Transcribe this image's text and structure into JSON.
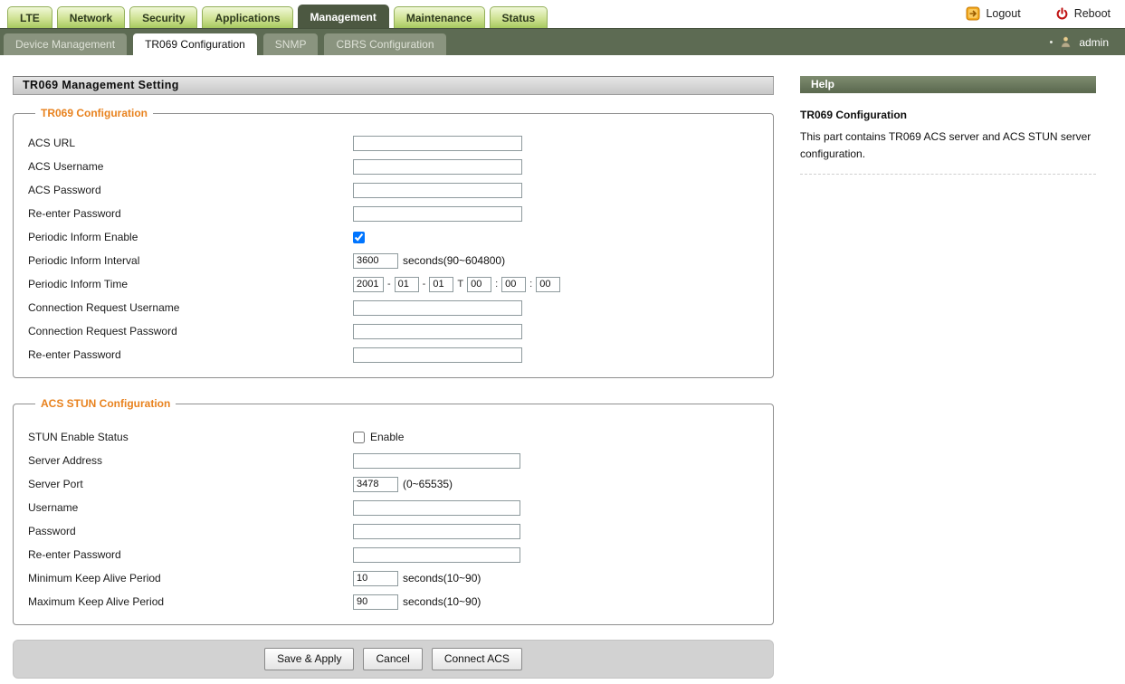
{
  "header": {
    "tabs": [
      {
        "label": "LTE"
      },
      {
        "label": "Network"
      },
      {
        "label": "Security"
      },
      {
        "label": "Applications"
      },
      {
        "label": "Management"
      },
      {
        "label": "Maintenance"
      },
      {
        "label": "Status"
      }
    ],
    "logout_label": "Logout",
    "reboot_label": "Reboot"
  },
  "subnav": {
    "tabs": [
      {
        "label": "Device Management"
      },
      {
        "label": "TR069 Configuration"
      },
      {
        "label": "SNMP"
      },
      {
        "label": "CBRS Configuration"
      }
    ],
    "bullet": "•",
    "user": "admin"
  },
  "main": {
    "title": "TR069 Management Setting",
    "tr069": {
      "legend": "TR069 Configuration",
      "acs_url_label": "ACS URL",
      "acs_username_label": "ACS Username",
      "acs_password_label": "ACS Password",
      "reenter_password_label": "Re-enter Password",
      "periodic_inform_enable_label": "Periodic Inform Enable",
      "periodic_inform_enable_checked": "checked",
      "periodic_inform_interval_label": "Periodic Inform Interval",
      "periodic_inform_interval_value": "3600",
      "periodic_inform_interval_hint": "seconds(90~604800)",
      "periodic_inform_time_label": "Periodic Inform Time",
      "time": {
        "year": "2001",
        "month": "01",
        "day": "01",
        "hour": "00",
        "minute": "00",
        "second": "00",
        "date_separator": "-",
        "t_separator": "T",
        "colon_separator": ":"
      },
      "connection_request_username_label": "Connection Request Username",
      "connection_request_password_label": "Connection Request Password",
      "reenter_password2_label": "Re-enter Password"
    },
    "stun": {
      "legend": "ACS STUN Configuration",
      "stun_enable_label": "STUN Enable Status",
      "stun_enable_option_label": "Enable",
      "server_address_label": "Server Address",
      "server_port_label": "Server Port",
      "server_port_value": "3478",
      "server_port_hint": "(0~65535)",
      "username_label": "Username",
      "password_label": "Password",
      "reenter_password_label": "Re-enter Password",
      "min_keep_alive_label": "Minimum Keep Alive Period",
      "min_keep_alive_value": "10",
      "min_keep_alive_hint": "seconds(10~90)",
      "max_keep_alive_label": "Maximum Keep Alive Period",
      "max_keep_alive_value": "90",
      "max_keep_alive_hint": "seconds(10~90)"
    },
    "actions": {
      "save_label": "Save & Apply",
      "cancel_label": "Cancel",
      "connect_label": "Connect ACS"
    }
  },
  "help": {
    "header": "Help",
    "title": "TR069 Configuration",
    "text": "This part contains TR069 ACS server and ACS STUN server configuration."
  },
  "colors": {
    "accent_orange": "#e8821e",
    "nav_active_dark": "#4c5841",
    "subnav_bar": "#5d6b53",
    "tab_green": "#a6c95f",
    "help_header": "#5a684e"
  }
}
